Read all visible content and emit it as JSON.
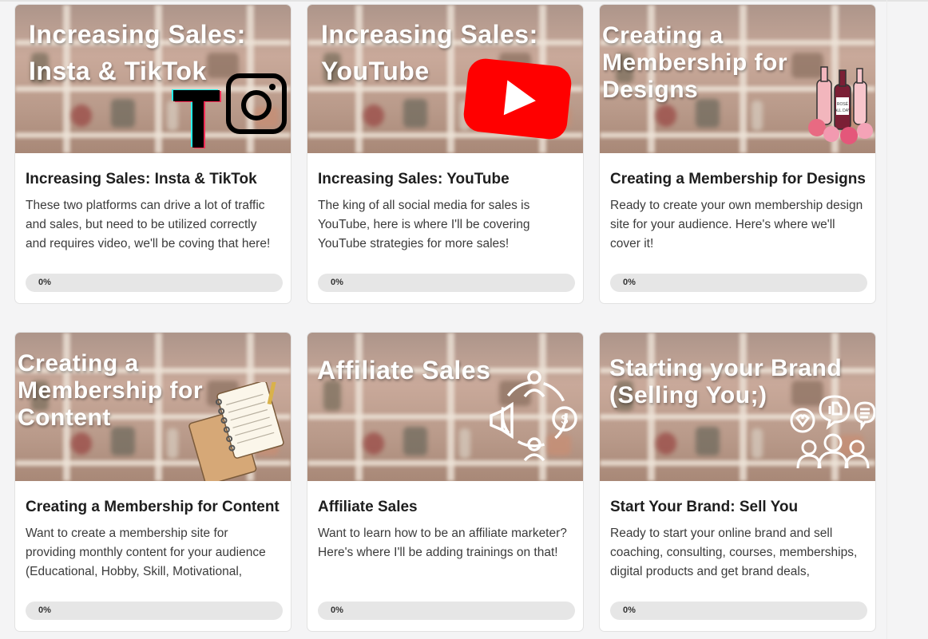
{
  "cards": [
    {
      "thumb_lines": [
        "Increasing Sales:",
        "Insta & TikTok"
      ],
      "title": "Increasing Sales: Insta & TikTok",
      "description": "These two platforms can drive a lot of traffic and sales, but need to be utilized correctly and requires video, we'll be coving that here!",
      "progress_label": "0%",
      "progress": 0,
      "icons": [
        "tiktok-icon",
        "instagram-icon"
      ]
    },
    {
      "thumb_lines": [
        "Increasing Sales:",
        "YouTube"
      ],
      "title": "Increasing Sales: YouTube",
      "description": "The king of all social media for sales is YouTube, here is where I'll be covering YouTube strategies for more sales!",
      "progress_label": "0%",
      "progress": 0,
      "icons": [
        "youtube-icon"
      ]
    },
    {
      "thumb_lines": [
        "Creating a",
        "Membership for",
        "Designs"
      ],
      "title": "Creating a Membership for Designs",
      "description": "Ready to create your own membership design site for your audience. Here's where we'll cover it!",
      "progress_label": "0%",
      "progress": 0,
      "icons": [
        "wine-bottles-icon"
      ],
      "image_text": "ROSÉ ALL DAY"
    },
    {
      "thumb_lines": [
        "Creating a",
        "Membership for",
        "Content"
      ],
      "title": "Creating a Membership for Content",
      "description": "Want to create a membership site for providing monthly content for your audience (Educational, Hobby, Skill, Motivational,",
      "progress_label": "0%",
      "progress": 0,
      "icons": [
        "notebook-icon"
      ]
    },
    {
      "thumb_lines": [
        "Affiliate Sales"
      ],
      "title": "Affiliate Sales",
      "description": "Want to learn how to be an affiliate marketer? Here's where I'll be adding trainings on that!",
      "progress_label": "0%",
      "progress": 0,
      "icons": [
        "affiliate-network-icon"
      ]
    },
    {
      "thumb_lines": [
        "Starting your Brand",
        "(Selling You;)"
      ],
      "title": "Start Your Brand: Sell You",
      "description": "Ready to start your online brand and sell coaching, consulting, courses, memberships, digital products and get brand deals,",
      "progress_label": "0%",
      "progress": 0,
      "icons": [
        "audience-feedback-icon"
      ]
    }
  ],
  "colors": {
    "youtube_red": "#ff0000",
    "progress_track": "#e6e6e6",
    "title_text": "#1e1e1e",
    "body_text": "#3b3b3b"
  }
}
